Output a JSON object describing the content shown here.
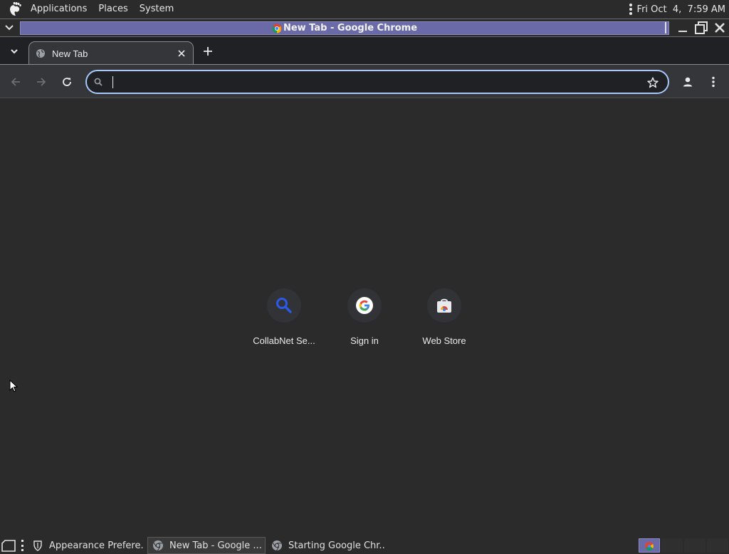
{
  "top_panel": {
    "menus": [
      "Applications",
      "Places",
      "System"
    ],
    "clock": "Fri Oct  4,  7:59 AM"
  },
  "window": {
    "title": "New Tab - Google Chrome"
  },
  "tabs": [
    {
      "title": "New Tab"
    }
  ],
  "omnibox": {
    "value": "",
    "placeholder": ""
  },
  "shortcuts": [
    {
      "label": "CollabNet Se...",
      "icon": "search-icon"
    },
    {
      "label": "Sign in",
      "icon": "google-g-icon"
    },
    {
      "label": "Web Store",
      "icon": "chrome-web-store-icon"
    }
  ],
  "taskbar": {
    "tasks": [
      {
        "label": "Appearance Prefere...",
        "icon": "appearance-icon",
        "active": false
      },
      {
        "label": "New Tab - Google ...",
        "icon": "chrome-icon",
        "active": true
      },
      {
        "label": "Starting Google Chr...",
        "icon": "chrome-icon",
        "active": false
      }
    ]
  },
  "colors": {
    "accent_focus": "#a8c7fa",
    "title_bar_active": "#6a6aa8",
    "background": "#2b2b2b"
  }
}
